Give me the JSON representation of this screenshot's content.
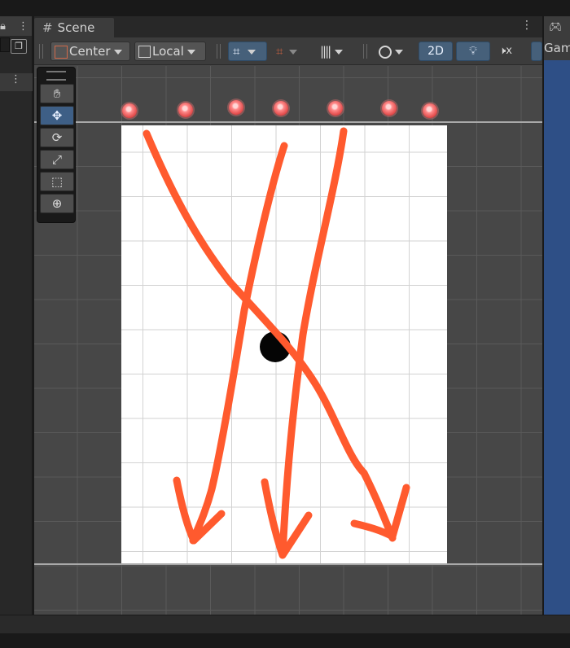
{
  "scene_window": {
    "tab_label": "Scene",
    "tab_icon": "hash-icon",
    "toolbar": {
      "pivot_label": "Center",
      "space_label": "Local",
      "mode_2d_label": "2D",
      "icons": [
        "grid-snap-icon",
        "increment-snap-icon",
        "gizmos-icon",
        "draw-mode-icon",
        "lighting-icon",
        "audio-mute-icon"
      ]
    },
    "tools": [
      "hand-tool",
      "move-tool",
      "rotate-tool",
      "scale-tool",
      "rect-tool",
      "transform-tool"
    ],
    "selected_tool": "move-tool"
  },
  "game_window": {
    "tab_label": "Gam"
  },
  "colors": {
    "annotation_arrows": "#ff5a2e",
    "markers": "#e04848",
    "selected_tool": "#3e5f86",
    "game_background": "#2e4f86"
  }
}
